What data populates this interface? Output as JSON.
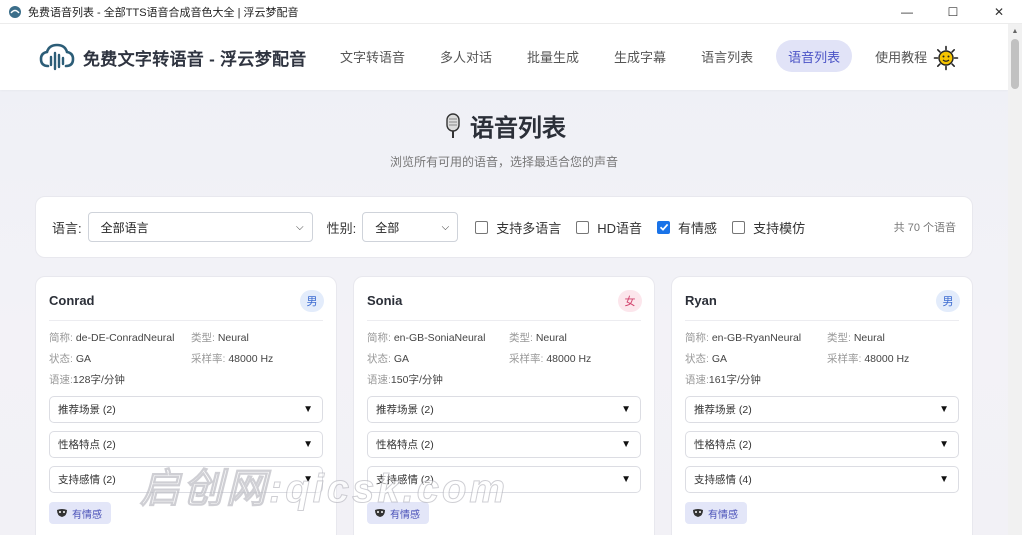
{
  "window": {
    "title": "免费语音列表 - 全部TTS语音合成音色大全 | 浮云梦配音",
    "controls": {
      "minimize": "—",
      "maximize": "☐",
      "close": "✕"
    }
  },
  "navbar": {
    "brand": "免费文字转语音 - 浮云梦配音",
    "items": [
      {
        "label": "文字转语音"
      },
      {
        "label": "多人对话"
      },
      {
        "label": "批量生成"
      },
      {
        "label": "生成字幕"
      },
      {
        "label": "语言列表"
      },
      {
        "label": "语音列表",
        "active": true
      },
      {
        "label": "使用教程"
      }
    ],
    "theme_icon": "sun-icon"
  },
  "page": {
    "title": "语音列表",
    "subtitle": "浏览所有可用的语音，选择最适合您的声音"
  },
  "filters": {
    "language_label": "语言:",
    "language_value": "全部语言",
    "gender_label": "性别:",
    "gender_value": "全部",
    "checkboxes": [
      {
        "label": "支持多语言",
        "checked": false
      },
      {
        "label": "HD语音",
        "checked": false
      },
      {
        "label": "有情感",
        "checked": true
      },
      {
        "label": "支持模仿",
        "checked": false
      }
    ],
    "count": "共 70 个语音"
  },
  "labels": {
    "short_name": "简称:",
    "type": "类型:",
    "status": "状态:",
    "sample_rate": "采样率:",
    "speed": "语速:"
  },
  "cards": [
    {
      "name": "Conrad",
      "gender": "男",
      "gender_kind": "male",
      "short_name": "de-DE-ConradNeural",
      "type": "Neural",
      "status": "GA",
      "sample_rate": "48000 Hz",
      "speed": "128字/分钟",
      "dropdowns": [
        "推荐场景 (2)",
        "性格特点 (2)",
        "支持感情 (2)"
      ],
      "tag": "有情感"
    },
    {
      "name": "Sonia",
      "gender": "女",
      "gender_kind": "female",
      "short_name": "en-GB-SoniaNeural",
      "type": "Neural",
      "status": "GA",
      "sample_rate": "48000 Hz",
      "speed": "150字/分钟",
      "dropdowns": [
        "推荐场景 (2)",
        "性格特点 (2)",
        "支持感情 (2)"
      ],
      "tag": "有情感"
    },
    {
      "name": "Ryan",
      "gender": "男",
      "gender_kind": "male",
      "short_name": "en-GB-RyanNeural",
      "type": "Neural",
      "status": "GA",
      "sample_rate": "48000 Hz",
      "speed": "161字/分钟",
      "dropdowns": [
        "推荐场景 (2)",
        "性格特点 (2)",
        "支持感情 (4)"
      ],
      "tag": "有情感"
    }
  ],
  "watermark": "启创网:qicsk.com",
  "colors": {
    "accent": "#4b53c6",
    "accent_bg": "#e1e3f7",
    "checkbox": "#1a73e8"
  }
}
